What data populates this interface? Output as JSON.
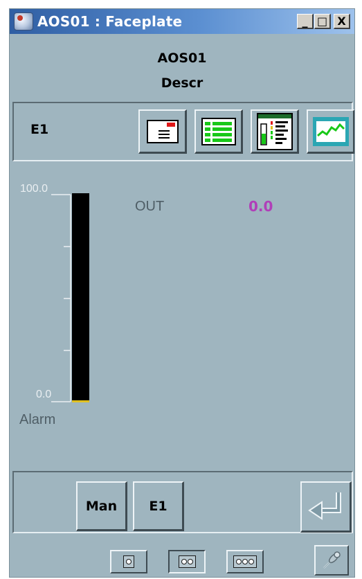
{
  "window": {
    "title": "AOS01 : Faceplate",
    "controls": {
      "minimize": "_",
      "maximize": "□",
      "close": "X"
    }
  },
  "header": {
    "tag": "AOS01",
    "description": "Descr"
  },
  "toolbar": {
    "mode_label": "E1",
    "buttons": [
      {
        "icon": "message-icon"
      },
      {
        "icon": "alarm-list-icon"
      },
      {
        "icon": "detail-bars-icon"
      },
      {
        "icon": "trend-icon"
      }
    ]
  },
  "main": {
    "scale_max": "100.0",
    "scale_min": "0.0",
    "alarm_label": "Alarm",
    "out_label": "OUT",
    "out_value": "0.0",
    "bar_fill_fraction": 0.0
  },
  "mode_buttons": {
    "manual": "Man",
    "external": "E1"
  },
  "footer": {
    "size_options": [
      "small",
      "medium",
      "large"
    ],
    "selected_size": "medium",
    "pin_icon": "pin-icon"
  },
  "colors": {
    "window_bg": "#9fb5bf",
    "out_value": "#b03fb8",
    "bar": "#000000",
    "bar_zero_marker": "#e0c020"
  }
}
